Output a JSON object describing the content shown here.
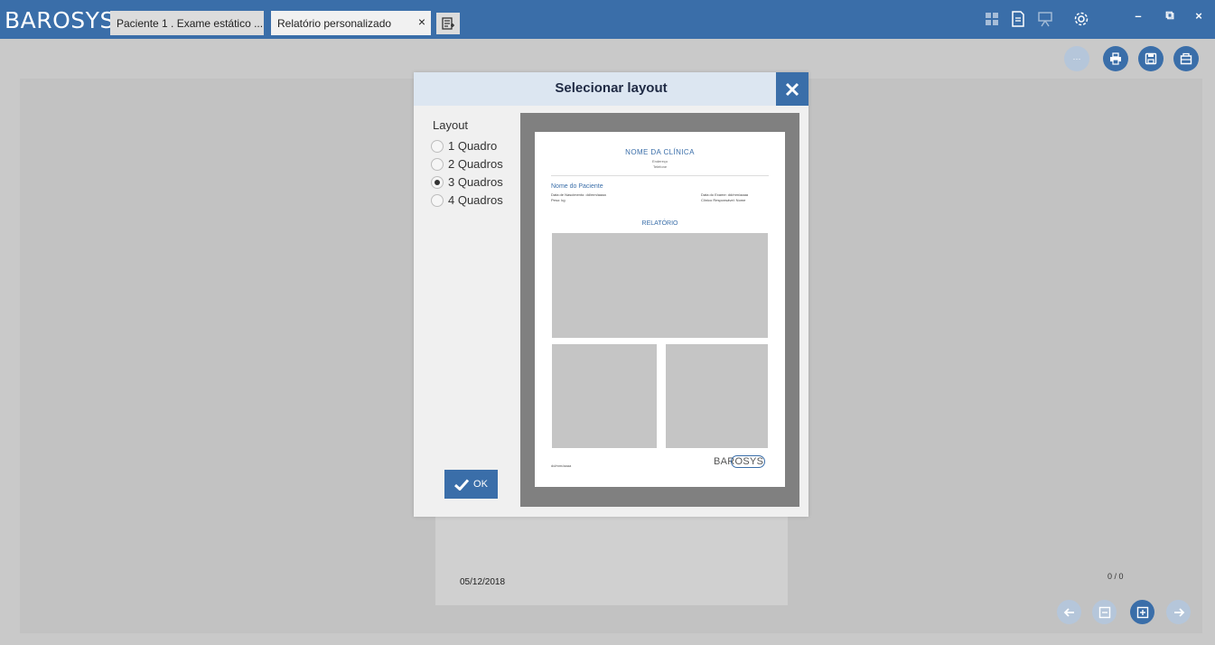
{
  "app": {
    "logo_text": "BAROSYS"
  },
  "tabs": [
    {
      "label": "Paciente 1 . Exame estático ..."
    },
    {
      "label": "Relatório personalizado",
      "close": "×"
    }
  ],
  "header_icons": [
    "dashboard-icon",
    "document-icon",
    "presentation-icon",
    "settings-icon"
  ],
  "window_controls": {
    "minimize": "–",
    "restore": "⧉",
    "close": "×"
  },
  "toolbar": {
    "more": "···",
    "icons": [
      "print-icon",
      "save-icon",
      "export-icon"
    ]
  },
  "dialog": {
    "title": "Selecionar layout",
    "layout_label": "Layout",
    "options": [
      {
        "label": "1 Quadro",
        "checked": false
      },
      {
        "label": "2 Quadros",
        "checked": false
      },
      {
        "label": "3 Quadros",
        "checked": true
      },
      {
        "label": "4 Quadros",
        "checked": false
      }
    ],
    "ok_label": "OK"
  },
  "preview": {
    "clinic_name": "NOME DA CLÍNICA",
    "address": "Endereço",
    "phone": "Telefone",
    "patient_name": "Nome do Paciente",
    "birth_date": "Data de Nascimento: dd/mm/aaaa",
    "record": "Peso: kg",
    "exam_date": "Data do Exame: dd/mm/aaaa",
    "responsible": "Clínico Responsável: Nome",
    "report_title": "RELATÓRIO",
    "footer_date": "dd/mm/aaaa",
    "logo_text": "BAROSYS"
  },
  "report": {
    "date": "05/12/2018",
    "page_counter": "0 / 0"
  },
  "colors": {
    "accent": "#3a6ea9",
    "header_bg": "#dce6f1",
    "disabled": "#b5c6da"
  }
}
